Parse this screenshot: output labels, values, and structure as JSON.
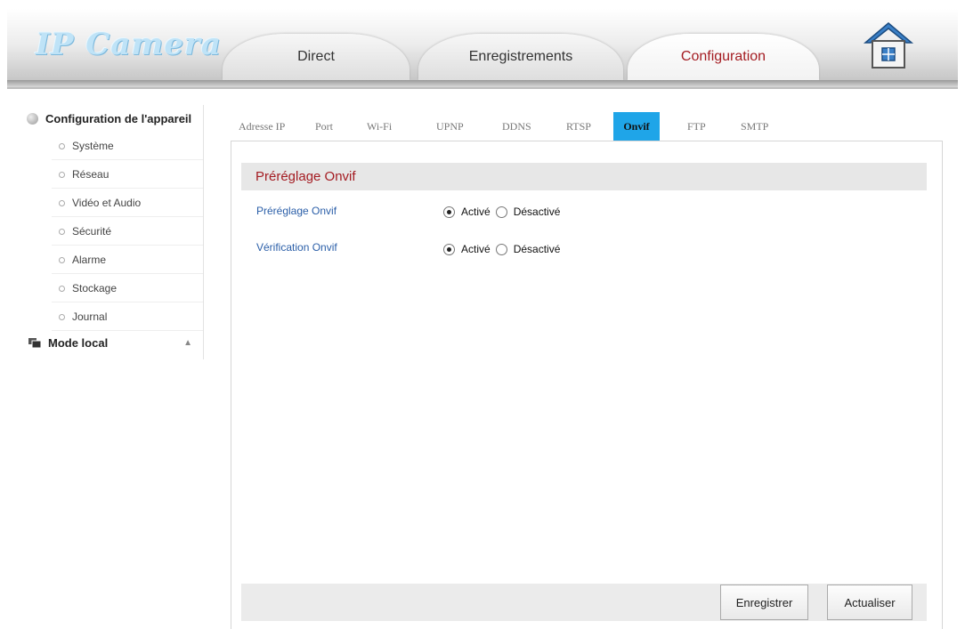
{
  "header": {
    "logo": "IP Camera",
    "tabs": [
      {
        "label": "Direct"
      },
      {
        "label": "Enregistrements"
      },
      {
        "label": "Configuration"
      }
    ],
    "active_tab": "Configuration"
  },
  "sidebar": {
    "section_title": "Configuration de l'appareil",
    "items": [
      {
        "label": "Système"
      },
      {
        "label": "Réseau"
      },
      {
        "label": "Vidéo et Audio"
      },
      {
        "label": "Sécurité"
      },
      {
        "label": "Alarme"
      },
      {
        "label": "Stockage"
      },
      {
        "label": "Journal"
      }
    ],
    "local_mode": "Mode local"
  },
  "subtabs": [
    {
      "label": "Adresse IP"
    },
    {
      "label": "Port"
    },
    {
      "label": "Wi-Fi"
    },
    {
      "label": "UPNP"
    },
    {
      "label": "DDNS"
    },
    {
      "label": "RTSP"
    },
    {
      "label": "Onvif"
    },
    {
      "label": "FTP"
    },
    {
      "label": "SMTP"
    }
  ],
  "active_subtab": "Onvif",
  "panel": {
    "title": "Préréglage Onvif",
    "rows": [
      {
        "label": "Préréglage Onvif",
        "option_on": "Activé",
        "option_off": "Désactivé",
        "selected": "Activé"
      },
      {
        "label": "Vérification Onvif",
        "option_on": "Activé",
        "option_off": "Désactivé",
        "selected": "Activé"
      }
    ]
  },
  "buttons": {
    "save": "Enregistrer",
    "refresh": "Actualiser"
  },
  "colors": {
    "accent_red": "#a41c22",
    "active_subtab_bg": "#1fa5e8",
    "label_blue": "#2a5ea8"
  }
}
